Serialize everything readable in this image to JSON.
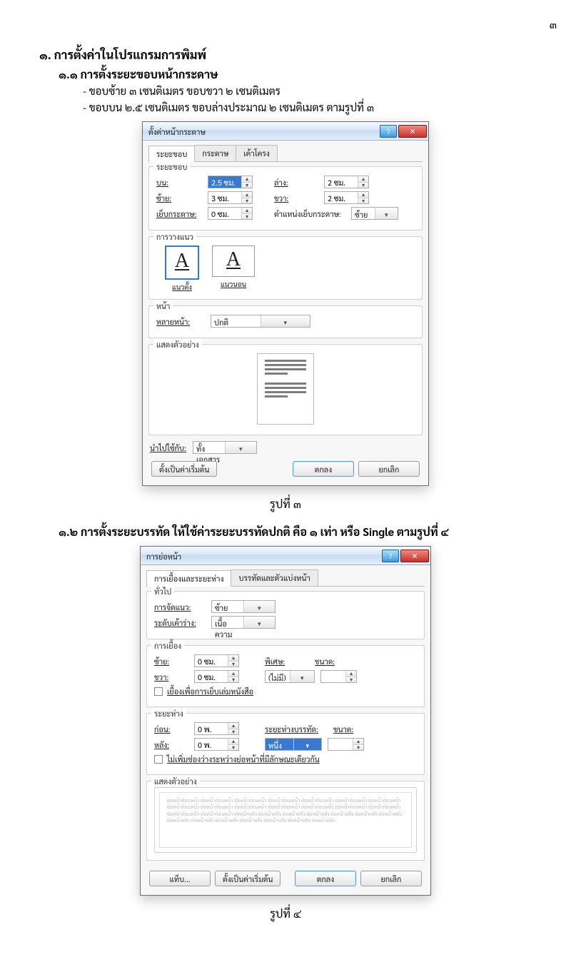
{
  "page_number": "๓",
  "heading1": "๑. การตั้งค่าในโปรแกรมการพิมพ์",
  "heading1_1": "๑.๑  การตั้งระยะขอบหน้ากระดาษ",
  "line1": "- ขอบซ้าย ๓ เซนติเมตร ขอบขวา ๒ เซนติเมตร",
  "line2": "- ขอบบน ๒.๕ เซนติเมตร ขอบล่างประมาณ ๒ เซนติเมตร  ตามรูปที่ ๓",
  "caption1": "รูปที่ ๓",
  "heading1_2": "๑.๒   การตั้งระยะบรรทัด ให้ใช้ค่าระยะบรรทัดปกติ คือ ๑ เท่า หรือ Single ตามรูปที่ ๔",
  "caption2": "รูปที่ ๔",
  "dlg1": {
    "title": "ตั้งค่าหน้ากระดาษ",
    "tabs": {
      "t1": "ระยะขอบ",
      "t2": "กระดาษ",
      "t3": "เค้าโครง"
    },
    "group_margins": "ระยะขอบ",
    "lbl_top": "บน:",
    "lbl_bottom": "ล่าง:",
    "lbl_left": "ซ้าย:",
    "lbl_right": "ขวา:",
    "lbl_gutter": "เย็บกระดาษ:",
    "lbl_gutterpos": "ตำแหน่งเย็บกระดาษ:",
    "val_top": "2.5 ซม.",
    "val_bottom": "2 ซม.",
    "val_left": "3 ซม.",
    "val_right": "2 ซม.",
    "val_gutter": "0 ซม.",
    "val_gutterpos": "ซ้าย",
    "group_orient": "การวางแนว",
    "orient_portrait": "แนวตั้ง",
    "orient_landscape": "แนวนอน",
    "group_pages": "หน้า",
    "lbl_multipage": "หลายหน้า:",
    "val_multipage": "ปกติ",
    "group_preview": "แสดงตัวอย่าง",
    "lbl_apply": "นำไปใช้กับ:",
    "val_apply": "ทั้งเอกสาร",
    "btn_default": "ตั้งเป็นค่าเริ่มต้น",
    "btn_ok": "ตกลง",
    "btn_cancel": "ยกเลิก"
  },
  "dlg2": {
    "title": "การย่อหน้า",
    "tabs": {
      "t1": "การเยื้องและระยะห่าง",
      "t2": "บรรทัดและตัวแบ่งหน้า"
    },
    "group_general": "ทั่วไป",
    "lbl_align": "การจัดแนว:",
    "val_align": "ซ้าย",
    "lbl_outline": "ระดับเค้าร่าง:",
    "val_outline": "เนื้อความ",
    "group_indent": "การเยื้อง",
    "lbl_left": "ซ้าย:",
    "lbl_right": "ขวา:",
    "val_left": "0 ซม.",
    "val_right": "0 ซม.",
    "lbl_special": "พิเศษ:",
    "val_special": "(ไม่มี)",
    "lbl_by1": "ขนาด:",
    "chk_mirror": "เยื้องเพื่อการเย็บเล่มหนังสือ",
    "group_spacing": "ระยะห่าง",
    "lbl_before": "ก่อน:",
    "lbl_after": "หลัง:",
    "val_before": "0 พ.",
    "val_after": "0 พ.",
    "lbl_linespace": "ระยะห่างบรรทัด:",
    "val_linespace": "หนึ่งเท่า",
    "lbl_at": "ขนาด:",
    "chk_nospace": "ไม่เพิ่มช่องว่างระหว่างย่อหน้าที่มีลักษณะเดียวกัน",
    "group_preview": "แสดงตัวอย่าง",
    "sample_text": "ย่อหน้าก่อนหน้า ย่อหน้าก่อนหน้า ย่อหน้าก่อนหน้า ย่อหน้าก่อนหน้า ย่อหน้าก่อนหน้า ย่อหน้าก่อนหน้า ย่อหน้าก่อนหน้า ย่อหน้าก่อนหน้า ย่อหน้าก่อนหน้า ย่อหน้าก่อนหน้า ย่อหน้าก่อนหน้า ย่อหน้าก่อนหน้า ย่อหน้าก่อนหน้า ย่อหน้าก่อนหน้า ย่อหน้าก่อนหน้า ย่อหน้าก่อนหน้า ย่อหน้าหลัง ย่อหน้าหลัง ย่อหน้าหลัง ย่อหน้าหลัง ย่อหน้าหลัง ย่อหน้าหลัง ย่อหน้าหลัง ย่อหน้าหลัง ย่อหน้าหลัง ย่อหน้าหลัง ย่อหน้าหลัง ย่อหน้าหลัง ย่อหน้าหลัง ย่อหน้าหลัง",
    "btn_tabs": "แท็บ...",
    "btn_default": "ตั้งเป็นค่าเริ่มต้น",
    "btn_ok": "ตกลง",
    "btn_cancel": "ยกเลิก"
  }
}
